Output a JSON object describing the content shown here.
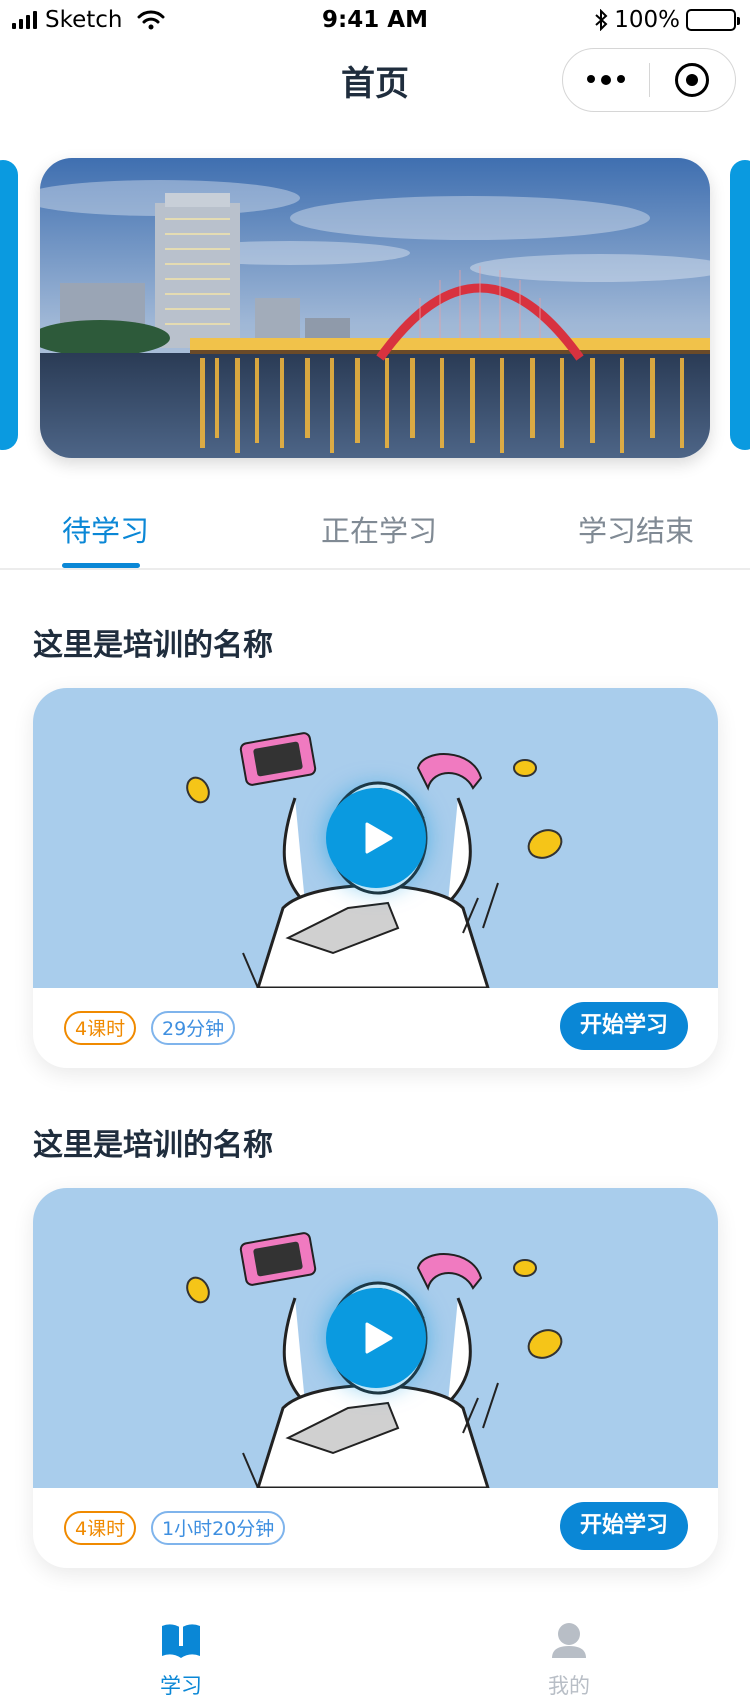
{
  "status_bar": {
    "carrier": "Sketch",
    "time": "9:41 AM",
    "battery": "100%"
  },
  "nav": {
    "title": "首页"
  },
  "tabs": [
    {
      "label": "待学习",
      "active": true
    },
    {
      "label": "正在学习",
      "active": false
    },
    {
      "label": "学习结束",
      "active": false
    }
  ],
  "courses": [
    {
      "title": "这里是培训的名称",
      "hours_tag": "4课时",
      "duration_tag": "29分钟",
      "action_label": "开始学习"
    },
    {
      "title": "这里是培训的名称",
      "hours_tag": "4课时",
      "duration_tag": "1小时20分钟",
      "action_label": "开始学习"
    }
  ],
  "tabbar": [
    {
      "label": "学习",
      "icon": "book-icon",
      "active": true
    },
    {
      "label": "我的",
      "icon": "user-icon",
      "active": false
    }
  ],
  "colors": {
    "accent": "#0a87d6",
    "hours_tag": "#f08a00",
    "duration_tag": "#3e8fe0",
    "cover_bg": "#a9cdec"
  }
}
